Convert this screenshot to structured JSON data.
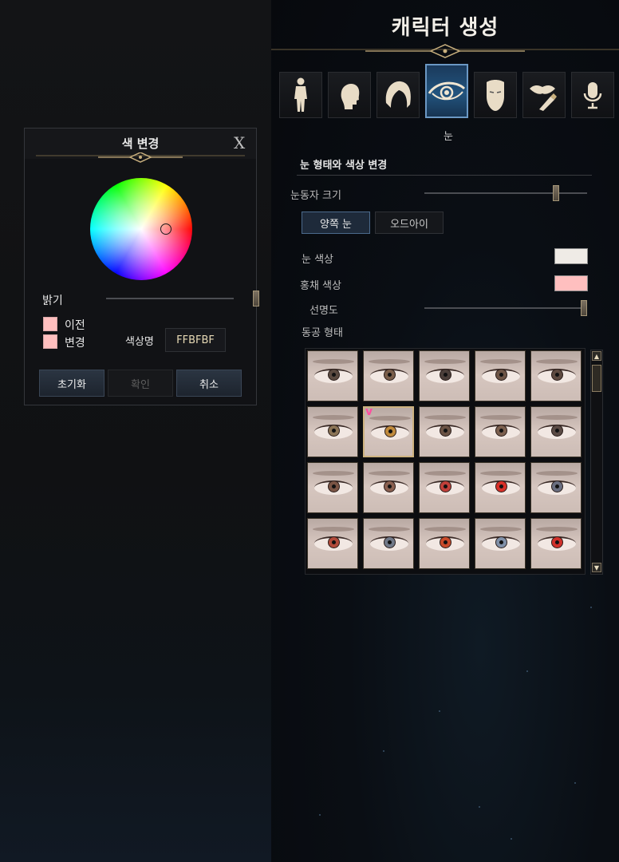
{
  "header": {
    "title": "캐릭터 생성"
  },
  "tabs": [
    {
      "icon": "body-icon",
      "label": ""
    },
    {
      "icon": "head-icon",
      "label": ""
    },
    {
      "icon": "hair-icon",
      "label": ""
    },
    {
      "icon": "eye-icon",
      "label": "눈",
      "active": true
    },
    {
      "icon": "face-icon",
      "label": ""
    },
    {
      "icon": "lips-icon",
      "label": ""
    },
    {
      "icon": "microphone-icon",
      "label": ""
    }
  ],
  "active_tab_label": "눈",
  "eye_panel": {
    "section_title": "눈 형태와 색상 변경",
    "pupil_size_label": "눈동자 크기",
    "pupil_size_value": 0.82,
    "mode_buttons": {
      "both": "양쪽 눈",
      "odd": "오드아이"
    },
    "eye_color_label": "눈 색상",
    "eye_color": "#efebe6",
    "iris_color_label": "홍채 색상",
    "iris_color": "#ffbfbf",
    "clarity_label": "선명도",
    "clarity_value": 1.0,
    "pupil_shape_label": "동공 형태",
    "selected_cell_marker": "v",
    "pupil_cells": [
      [
        "#5b4a40",
        "#7a5e4a",
        "#4b3f3a",
        "#6e5546",
        "#5e4a40"
      ],
      [
        "#8a7355",
        "#c08a3c",
        "#6a5244",
        "#7b5f4e",
        "#5a4a44"
      ],
      [
        "#7a5444",
        "#8a6050",
        "#c0403a",
        "#d83028",
        "#6a6e80"
      ],
      [
        "#b04a3a",
        "#707888",
        "#c84a2a",
        "#8090a8",
        "#d0302a"
      ]
    ]
  },
  "color_dialog": {
    "title": "색 변경",
    "close": "X",
    "brightness_label": "밝기",
    "brightness_value": 1.0,
    "previous_label": "이전",
    "previous_color": "#ffbfbf",
    "changed_label": "변경",
    "changed_color": "#ffbfbf",
    "hex_label": "색상명",
    "hex_value": "FFBFBF",
    "buttons": {
      "reset": "초기화",
      "confirm": "확인",
      "cancel": "취소"
    }
  }
}
